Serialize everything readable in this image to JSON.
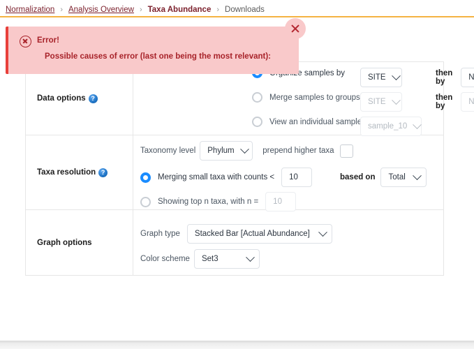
{
  "breadcrumb": {
    "items": [
      {
        "label": "Normalization",
        "type": "link"
      },
      {
        "label": "Analysis Overview",
        "type": "link"
      },
      {
        "label": "Taxa Abundance",
        "type": "current"
      },
      {
        "label": "Downloads",
        "type": "plain"
      }
    ],
    "separator": "›",
    "rule_color": "#f5b342"
  },
  "error_banner": {
    "title": "Error!",
    "subtitle": "Possible causes of error (last one being the most relevant):",
    "icon": "error-circle-x-icon",
    "close_label": "×",
    "background": "#f9c9ca",
    "accent": "#e8403a",
    "text_color": "#a8232a"
  },
  "sections": {
    "data_options": {
      "label": "Data options",
      "help": "?",
      "options": [
        {
          "label": "Organize samples by",
          "selected": true,
          "primary_select": {
            "value": "SITE",
            "enabled": true
          },
          "then_by_label": "then by",
          "secondary_select": {
            "value": "None",
            "enabled": true
          }
        },
        {
          "label": "Merge samples to groups",
          "selected": false,
          "primary_select": {
            "value": "SITE",
            "enabled": false
          },
          "then_by_label": "then by",
          "secondary_select": {
            "value": "None",
            "enabled": false
          }
        },
        {
          "label": "View an individual sample",
          "selected": false,
          "primary_select": {
            "value": "sample_10",
            "enabled": false
          }
        }
      ]
    },
    "taxa_resolution": {
      "label": "Taxa resolution",
      "help": "?",
      "taxonomy_level_label": "Taxonomy level",
      "taxonomy_level_value": "Phylum",
      "prepend_label": "prepend higher taxa",
      "prepend_checked": false,
      "merge_option": {
        "label": "Merging small taxa with counts <",
        "selected": true,
        "value": "10",
        "enabled": true
      },
      "topn_option": {
        "label": "Showing top n taxa,   with n =",
        "selected": false,
        "value": "10",
        "enabled": false
      },
      "based_on_label": "based on",
      "based_on_value": "Total"
    },
    "graph_options": {
      "label": "Graph options",
      "graph_type_label": "Graph type",
      "graph_type_value": "Stacked Bar [Actual Abundance]",
      "color_scheme_label": "Color scheme",
      "color_scheme_value": "Set3"
    }
  }
}
